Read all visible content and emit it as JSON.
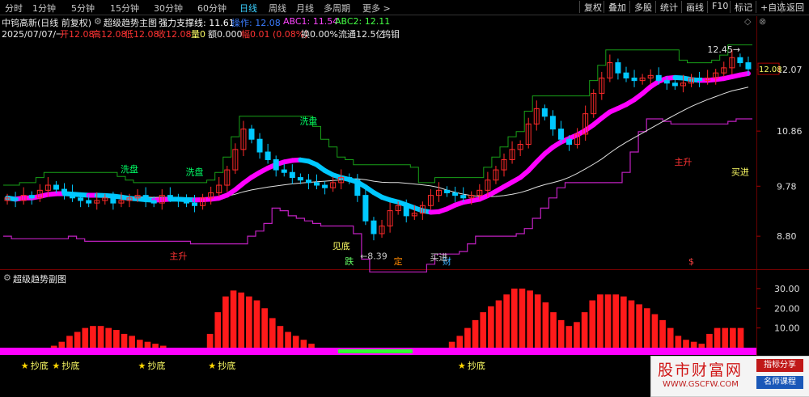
{
  "toolbar": {
    "timeframes": [
      "分时",
      "1分钟",
      "5分钟",
      "15分钟",
      "30分钟",
      "60分钟",
      "日线",
      "周线",
      "月线",
      "多周期",
      "更多 >"
    ],
    "active_index": 6,
    "buttons": [
      "复权",
      "叠加",
      "多股",
      "统计",
      "画线",
      "F10",
      "标记",
      "+自选",
      "返回"
    ]
  },
  "header": {
    "stock_name": "中钨高新(日线 前复权)",
    "indicator_name": "超级趋势主图",
    "support_label": "强力支撑线: 11.61",
    "op_label": "操作: 12.08",
    "abc1_label": "ABC1: 11.54",
    "abc2_label": "ABC2: 12.11",
    "date": "2025/07/07/一",
    "open": "开12.08",
    "high": "高12.08",
    "low": "低12.08",
    "close": "收12.08",
    "volume": "量0",
    "amount": "额0.000",
    "change": "幅0.01 (0.08%)",
    "turnover": "换0.00%",
    "float_cap": "流通12.5亿",
    "sector": "钨钼"
  },
  "sub_panel_title": "超级趋势副图",
  "colors": {
    "up": "#ff2a2a",
    "down": "#00c8ff",
    "magenta": "#ff00ff",
    "green": "#00cc00",
    "support": "#c020c0",
    "white": "#e0e0e0",
    "yellow": "#ffff66"
  },
  "chart_data": [
    {
      "type": "candlestick",
      "ylim": [
        8.2,
        12.7
      ],
      "y_ticks": [
        "12.07",
        "10.86",
        "9.78",
        "8.80"
      ],
      "y_tick_values": [
        12.07,
        10.86,
        9.78,
        8.8
      ],
      "close": [
        9.55,
        9.5,
        9.6,
        9.55,
        9.7,
        9.8,
        9.72,
        9.65,
        9.55,
        9.5,
        9.45,
        9.5,
        9.55,
        9.45,
        9.5,
        9.55,
        9.6,
        9.5,
        9.45,
        9.6,
        9.55,
        9.5,
        9.45,
        9.4,
        9.55,
        9.65,
        9.8,
        10.1,
        10.5,
        10.9,
        10.7,
        10.45,
        10.3,
        10.1,
        10.05,
        9.95,
        9.9,
        9.85,
        9.8,
        9.75,
        9.85,
        9.95,
        9.9,
        9.6,
        9.1,
        8.85,
        9.0,
        9.3,
        9.4,
        9.2,
        9.25,
        9.4,
        9.6,
        9.7,
        9.65,
        9.6,
        9.55,
        9.6,
        9.7,
        9.9,
        10.1,
        10.3,
        10.5,
        10.6,
        11.0,
        11.3,
        11.15,
        10.9,
        10.7,
        10.6,
        10.8,
        11.2,
        11.6,
        11.9,
        12.2,
        12.0,
        11.9,
        11.85,
        11.9,
        11.95,
        11.85,
        11.8,
        11.75,
        11.8,
        11.9,
        11.85,
        11.9,
        12.0,
        12.1,
        12.3,
        12.2,
        12.08
      ],
      "current_price": "12.08",
      "annotations": [
        {
          "text": "洗盘",
          "x_index": 15,
          "y": 10.05,
          "color": "#00ff66"
        },
        {
          "text": "洗盘",
          "x_index": 23,
          "y": 10.0,
          "color": "#00ff66"
        },
        {
          "text": "洗盘",
          "x_index": 37,
          "y": 11.0,
          "color": "#00ff66"
        },
        {
          "text": "见底",
          "x_index": 41,
          "y": 8.55,
          "color": "#ffff66"
        },
        {
          "text": "←8.39",
          "x_index": 45,
          "y": 8.35,
          "color": "#cccccc"
        },
        {
          "text": "主升",
          "x_index": 21,
          "y": 8.35,
          "color": "#ff3333"
        },
        {
          "text": "主升",
          "x_index": 83,
          "y": 10.2,
          "color": "#ff3333"
        },
        {
          "text": "买进",
          "x_index": 90,
          "y": 10.0,
          "color": "#ffff66"
        },
        {
          "text": "12.45→",
          "x_index": 88,
          "y": 12.4,
          "color": "#e0e0e0"
        },
        {
          "text": "跌",
          "x_index": 42,
          "y": 8.25,
          "color": "#66ff66"
        },
        {
          "text": "定",
          "x_index": 48,
          "y": 8.25,
          "color": "#ff8800"
        },
        {
          "text": "财",
          "x_index": 54,
          "y": 8.25,
          "color": "#3ab0ff"
        },
        {
          "text": "买进",
          "x_index": 53,
          "y": 8.33,
          "color": "#cccccc"
        },
        {
          "text": "$",
          "x_index": 84,
          "y": 8.25,
          "color": "#ff4444"
        }
      ]
    },
    {
      "type": "bar",
      "ylim": [
        0,
        32
      ],
      "y_ticks": [
        "30.00",
        "20.00",
        "10.00"
      ],
      "y_tick_values": [
        30,
        20,
        10
      ],
      "values": [
        0,
        0,
        0,
        0,
        0,
        0,
        1,
        3,
        6,
        8,
        10,
        11,
        11,
        10,
        9,
        7,
        6,
        4,
        3,
        2,
        1,
        0,
        0,
        0,
        0,
        0,
        7,
        18,
        26,
        29,
        28,
        26,
        24,
        20,
        15,
        11,
        8,
        6,
        4,
        2,
        0,
        0,
        0,
        0,
        0,
        0,
        0,
        0,
        0,
        0,
        0,
        0,
        0,
        0,
        0,
        0,
        0,
        3,
        6,
        10,
        14,
        18,
        21,
        24,
        27,
        30,
        30,
        29,
        27,
        23,
        18,
        14,
        11,
        13,
        18,
        24,
        27,
        27,
        27,
        26,
        24,
        22,
        20,
        17,
        14,
        10,
        6,
        4,
        3,
        2,
        7,
        10,
        10,
        10,
        10,
        0
      ],
      "signals": [
        {
          "text": "抄底",
          "x_index": 3
        },
        {
          "text": "抄底",
          "x_index": 7
        },
        {
          "text": "抄底",
          "x_index": 18
        },
        {
          "text": "抄底",
          "x_index": 27
        },
        {
          "text": "抄底",
          "x_index": 59
        }
      ]
    }
  ],
  "watermark": {
    "main": "股市财富网",
    "url": "WWW.GSCFW.COM",
    "badge1": "指标分享",
    "badge2": "名师课程"
  }
}
